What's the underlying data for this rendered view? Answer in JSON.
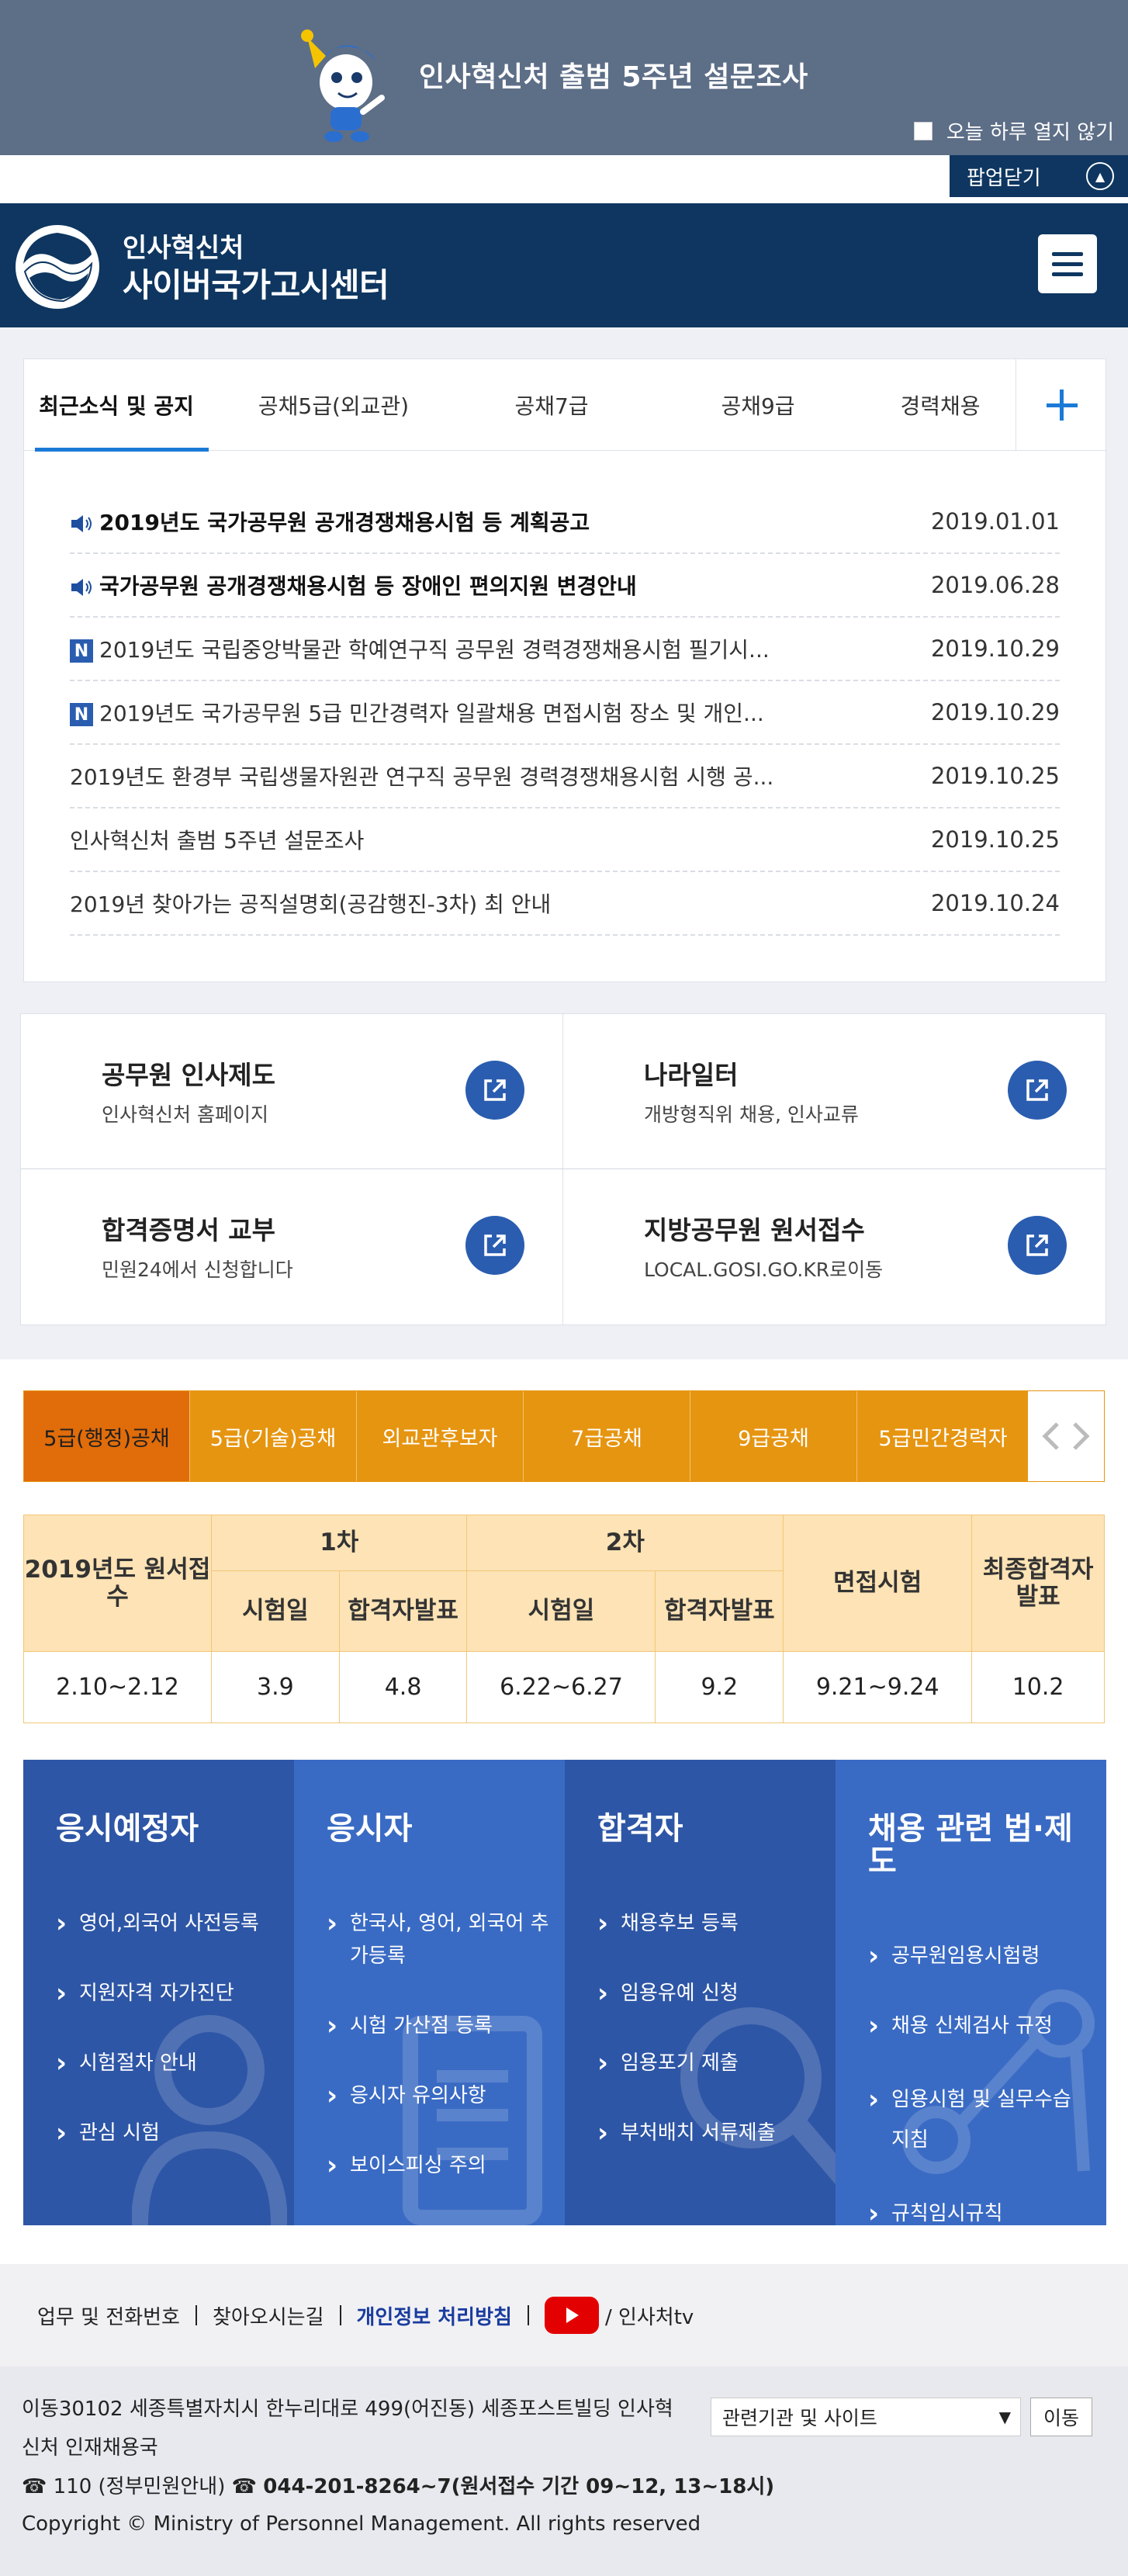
{
  "popup": {
    "title": "인사혁신처 출범 5주년 설문조사",
    "dont_show_today": "오늘 하루 열지 않기",
    "close_label": "팝업닫기"
  },
  "header": {
    "org_small": "인사혁신처",
    "org_big": "사이버국가고시센터"
  },
  "notice": {
    "tabs": [
      "최근소식 및 공지",
      "공채5급(외교관)",
      "공채7급",
      "공채9급",
      "경력채용"
    ],
    "active_tab": 0,
    "items": [
      {
        "badge": "speaker",
        "bold": true,
        "title": "2019년도 국가공무원 공개경쟁채용시험 등 계획공고",
        "date": "2019.01.01"
      },
      {
        "badge": "speaker",
        "bold": true,
        "title": "국가공무원 공개경쟁채용시험 등 장애인 편의지원 변경안내",
        "date": "2019.06.28"
      },
      {
        "badge": "N",
        "bold": false,
        "title": "2019년도 국립중앙박물관 학예연구직 공무원 경력경쟁채용시험 필기시...",
        "date": "2019.10.29"
      },
      {
        "badge": "N",
        "bold": false,
        "title": "2019년도 국가공무원 5급 민간경력자 일괄채용 면접시험 장소 및 개인...",
        "date": "2019.10.29"
      },
      {
        "badge": "",
        "bold": false,
        "title": "2019년도 환경부 국립생물자원관 연구직 공무원 경력경쟁채용시험 시행 공...",
        "date": "2019.10.25"
      },
      {
        "badge": "",
        "bold": false,
        "title": "인사혁신처 출범 5주년 설문조사",
        "date": "2019.10.25"
      },
      {
        "badge": "",
        "bold": false,
        "title": "2019년 찾아가는 공직설명회(공감행진-3차) 최 안내",
        "date": "2019.10.24"
      }
    ]
  },
  "quick_links": [
    {
      "title": "공무원 인사제도",
      "sub": "인사혁신처 홈페이지"
    },
    {
      "title": "나라일터",
      "sub": "개방형직위 채용, 인사교류"
    },
    {
      "title": "합격증명서 교부",
      "sub": "민원24에서 신청합니다"
    },
    {
      "title": "지방공무원 원서접수",
      "sub": "LOCAL.GOSI.GO.KR로이동"
    }
  ],
  "exam_tabs": [
    "5급(행정)공채",
    "5급(기술)공채",
    "외교관후보자",
    "7급공채",
    "9급공채",
    "5급민간경력자"
  ],
  "exam_active": 0,
  "schedule": {
    "year_label": "2019년도 원서접수",
    "round1": "1차",
    "round2": "2차",
    "interview": "면접시험",
    "final": "최종합격자 발표",
    "exam_day": "시험일",
    "pass_announce": "합격자발표",
    "values": {
      "apply": "2.10~2.12",
      "r1_exam": "3.9",
      "r1_pass": "4.8",
      "r2_exam": "6.22~6.27",
      "r2_pass": "9.2",
      "interview": "9.21~9.24",
      "final": "10.2"
    }
  },
  "roles": [
    {
      "title": "응시예정자",
      "color": "#2e56a6",
      "items": [
        "영어,외국어 사전등록",
        "지원자격 자가진단",
        "시험절차 안내",
        "관심 시험"
      ]
    },
    {
      "title": "응시자",
      "color": "#3a6bc4",
      "items": [
        "한국사, 영어, 외국어 추가등록",
        "시험 가산점 등록",
        "응시자 유의사항",
        "보이스피싱 주의"
      ]
    },
    {
      "title": "합격자",
      "color": "#2e56a6",
      "items": [
        "채용후보 등록",
        "임용유예 신청",
        "임용포기 제출",
        "부처배치 서류제출"
      ]
    },
    {
      "title": "채용 관련 법·제도",
      "color": "#3a6bc4",
      "items": [
        "공무원임용시험령",
        "채용 신체검사 규정",
        "임용시험 및 실무수습 지침",
        "규칙임시규칙"
      ]
    }
  ],
  "footer_links": {
    "work": "업무 및 전화번호",
    "directions": "찾아오시는길",
    "privacy": "개인정보 처리방침",
    "tv": "/ 인사처tv"
  },
  "footer": {
    "address": "이동30102 세종특별자치시 한누리대로 499(어진동) 세종포스트빌딩 인사혁신처 인재채용국",
    "phone_prefix": "☎ 110 (정부민원안내) ☎ ",
    "phone_main": "044-201-8264~7(원서접수 기간 09~12, 13~18시)",
    "copyright": "Copyright © Ministry of Personnel Management. All rights reserved",
    "select_label": "관련기관 및 사이트",
    "go_label": "이동"
  },
  "colors": {
    "navy": "#0e3660",
    "accent_blue": "#1a7ad6",
    "orange": "#e69511",
    "orange_active": "#e06c0a"
  }
}
